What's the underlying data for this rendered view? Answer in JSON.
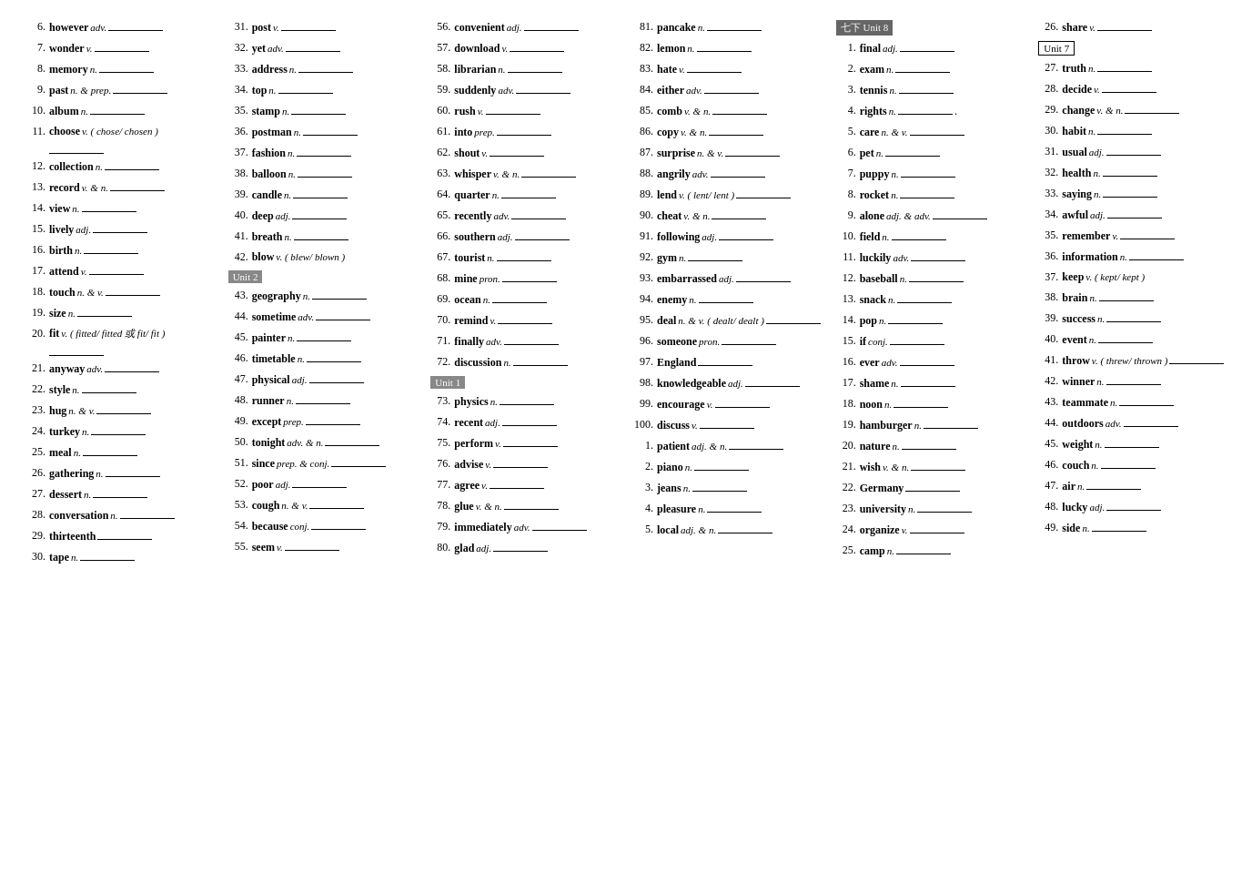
{
  "columns": [
    {
      "id": "col1",
      "entries": [
        {
          "num": "6.",
          "word": "however",
          "pos": "adv.",
          "line": true
        },
        {
          "num": "7.",
          "word": "wonder",
          "pos": "v.",
          "line": true
        },
        {
          "num": "8.",
          "word": "memory",
          "pos": "n.",
          "line": true
        },
        {
          "num": "9.",
          "word": "past",
          "pos": "n. & prep.",
          "line": true
        },
        {
          "num": "10.",
          "word": "album",
          "pos": "n.",
          "line": true
        },
        {
          "num": "11.",
          "word": "choose",
          "pos": "v.  ( chose/ chosen )",
          "note": true,
          "line": true
        },
        {
          "num": "12.",
          "word": "collection",
          "pos": "n.",
          "line": true
        },
        {
          "num": "13.",
          "word": "record",
          "pos": "v. & n.",
          "line": true
        },
        {
          "num": "14.",
          "word": "view",
          "pos": "n.",
          "line": true
        },
        {
          "num": "15.",
          "word": "lively",
          "pos": "adj.",
          "line": true
        },
        {
          "num": "16.",
          "word": "birth",
          "pos": "n.",
          "line": true
        },
        {
          "num": "17.",
          "word": "attend",
          "pos": "v.",
          "line": true
        },
        {
          "num": "18.",
          "word": "touch",
          "pos": "n. & v.",
          "line": true
        },
        {
          "num": "19.",
          "word": "size",
          "pos": "n.",
          "line": true
        },
        {
          "num": "20.",
          "word": "fit",
          "pos": "v.  ( fitted/ fitted 或 fit/ fit )",
          "note": true,
          "line": true
        },
        {
          "num": "21.",
          "word": "anyway",
          "pos": "adv.",
          "line": true
        },
        {
          "num": "22.",
          "word": "style",
          "pos": "n.",
          "line": true
        },
        {
          "num": "23.",
          "word": "hug",
          "pos": "n. & v.",
          "line": true
        },
        {
          "num": "24.",
          "word": "turkey",
          "pos": "n.",
          "line": true
        },
        {
          "num": "25.",
          "word": "meal",
          "pos": "n.",
          "line": true
        },
        {
          "num": "26.",
          "word": "gathering",
          "pos": "n.",
          "line": true
        },
        {
          "num": "27.",
          "word": "dessert",
          "pos": "n.",
          "line": true
        },
        {
          "num": "28.",
          "word": "conversation",
          "pos": "n.",
          "line": true
        },
        {
          "num": "29.",
          "word": "thirteenth",
          "pos": "",
          "line": true
        },
        {
          "num": "30.",
          "word": "tape",
          "pos": "n.",
          "line": true
        }
      ]
    },
    {
      "id": "col2",
      "entries": [
        {
          "num": "31.",
          "word": "post",
          "pos": "v.",
          "line": true
        },
        {
          "num": "32.",
          "word": "yet",
          "pos": "adv.",
          "line": true
        },
        {
          "num": "33.",
          "word": "address",
          "pos": "n.",
          "line": true
        },
        {
          "num": "34.",
          "word": "top",
          "pos": "n.",
          "line": true
        },
        {
          "num": "35.",
          "word": "stamp",
          "pos": "n.",
          "line": true
        },
        {
          "num": "36.",
          "word": "postman",
          "pos": "n.",
          "line": true
        },
        {
          "num": "37.",
          "word": "fashion",
          "pos": "n.",
          "line": true
        },
        {
          "num": "38.",
          "word": "balloon",
          "pos": "n.",
          "line": true
        },
        {
          "num": "39.",
          "word": "candle",
          "pos": "n.",
          "line": true
        },
        {
          "num": "40.",
          "word": "deep",
          "pos": "adj.",
          "line": true
        },
        {
          "num": "41.",
          "word": "breath",
          "pos": "n.",
          "line": true
        },
        {
          "num": "42.",
          "word": "blow",
          "pos": "v. ( blew/ blown )",
          "note": true
        },
        {
          "unit": "Unit 2"
        },
        {
          "num": "43.",
          "word": "geography",
          "pos": "n.",
          "line": true
        },
        {
          "num": "44.",
          "word": "sometime",
          "pos": "adv.",
          "line": true
        },
        {
          "num": "45.",
          "word": "painter",
          "pos": "n.",
          "line": true
        },
        {
          "num": "46.",
          "word": "timetable",
          "pos": "n.",
          "line": true
        },
        {
          "num": "47.",
          "word": "physical",
          "pos": "adj.",
          "line": true
        },
        {
          "num": "48.",
          "word": "runner",
          "pos": "n.",
          "line": true
        },
        {
          "num": "49.",
          "word": "except",
          "pos": "prep.",
          "line": true
        },
        {
          "num": "50.",
          "word": "tonight",
          "pos": "adv. & n.",
          "line": true
        },
        {
          "num": "51.",
          "word": "since",
          "pos": "prep. & conj.",
          "line": true
        },
        {
          "num": "52.",
          "word": "poor",
          "pos": "adj.",
          "line": true
        },
        {
          "num": "53.",
          "word": "cough",
          "pos": "n. & v.",
          "line": true
        },
        {
          "num": "54.",
          "word": "because",
          "pos": "conj.",
          "line": true
        },
        {
          "num": "55.",
          "word": "seem",
          "pos": "v.",
          "line": true
        }
      ]
    },
    {
      "id": "col3",
      "entries": [
        {
          "num": "56.",
          "word": "convenient",
          "pos": "adj.",
          "line": true
        },
        {
          "num": "57.",
          "word": "download",
          "pos": "v.",
          "line": true
        },
        {
          "num": "58.",
          "word": "librarian",
          "pos": "n.",
          "line": true
        },
        {
          "num": "59.",
          "word": "suddenly",
          "pos": "adv.",
          "line": true
        },
        {
          "num": "60.",
          "word": "rush",
          "pos": "v.",
          "line": true
        },
        {
          "num": "61.",
          "word": "into",
          "pos": "prep.",
          "line": true
        },
        {
          "num": "62.",
          "word": "shout",
          "pos": "v.",
          "line": true
        },
        {
          "num": "63.",
          "word": "whisper",
          "pos": "v. & n.",
          "line": true
        },
        {
          "num": "64.",
          "word": "quarter",
          "pos": "n.",
          "line": true
        },
        {
          "num": "65.",
          "word": "recently",
          "pos": "adv.",
          "line": true
        },
        {
          "num": "66.",
          "word": "southern",
          "pos": "adj.",
          "line": true
        },
        {
          "num": "67.",
          "word": "tourist",
          "pos": "n.",
          "line": true
        },
        {
          "num": "68.",
          "word": "mine",
          "pos": "pron.",
          "line": true
        },
        {
          "num": "69.",
          "word": "ocean",
          "pos": "n.",
          "line": true
        },
        {
          "num": "70.",
          "word": "remind",
          "pos": "v.",
          "line": true
        },
        {
          "num": "71.",
          "word": "finally",
          "pos": "adv.",
          "line": true
        },
        {
          "num": "72.",
          "word": "discussion",
          "pos": "n.",
          "line": true
        },
        {
          "unit": "Unit 1"
        },
        {
          "num": "73.",
          "word": "physics",
          "pos": "n.",
          "line": true
        },
        {
          "num": "74.",
          "word": "recent",
          "pos": "adj.",
          "line": true
        },
        {
          "num": "75.",
          "word": "perform",
          "pos": "v.",
          "line": true
        },
        {
          "num": "76.",
          "word": "advise",
          "pos": "v.",
          "line": true
        },
        {
          "num": "77.",
          "word": "agree",
          "pos": "v.",
          "line": true
        },
        {
          "num": "78.",
          "word": "glue",
          "pos": "v. & n.",
          "line": true
        },
        {
          "num": "79.",
          "word": "immediately",
          "pos": "adv.",
          "line": true
        },
        {
          "num": "80.",
          "word": "glad",
          "pos": "adj.",
          "line": true
        }
      ]
    },
    {
      "id": "col4",
      "entries": [
        {
          "num": "81.",
          "word": "pancake",
          "pos": "n.",
          "line": true
        },
        {
          "num": "82.",
          "word": "lemon",
          "pos": "n.",
          "line": true
        },
        {
          "num": "83.",
          "word": "hate",
          "pos": "v.",
          "line": true
        },
        {
          "num": "84.",
          "word": "either",
          "pos": "adv.",
          "line": true
        },
        {
          "num": "85.",
          "word": "comb",
          "pos": "v. & n.",
          "line": true
        },
        {
          "num": "86.",
          "word": "copy",
          "pos": "v. & n.",
          "line": true
        },
        {
          "num": "87.",
          "word": "surprise",
          "pos": "n. & v.",
          "line": true
        },
        {
          "num": "88.",
          "word": "angrily",
          "pos": "adv.",
          "line": true
        },
        {
          "num": "89.",
          "word": "lend",
          "pos": "v. ( lent/ lent )",
          "note": true,
          "line": true
        },
        {
          "num": "90.",
          "word": "cheat",
          "pos": "v. & n.",
          "line": true
        },
        {
          "num": "91.",
          "word": "following",
          "pos": "adj.",
          "line": true
        },
        {
          "num": "92.",
          "word": "gym",
          "pos": "n.",
          "line": true
        },
        {
          "num": "93.",
          "word": "embarrassed",
          "pos": "adj.",
          "line": true
        },
        {
          "num": "94.",
          "word": "enemy",
          "pos": "n.",
          "line": true
        },
        {
          "num": "95.",
          "word": "deal",
          "pos": "n. & v.  ( dealt/ dealt )",
          "note": true,
          "line": true
        },
        {
          "num": "96.",
          "word": "someone",
          "pos": "pron.",
          "line": true
        },
        {
          "num": "97.",
          "word": "England",
          "pos": "",
          "line": true
        },
        {
          "num": "98.",
          "word": "knowledgeable",
          "pos": "adj.",
          "line": true
        },
        {
          "num": "99.",
          "word": "encourage",
          "pos": "v.",
          "line": true
        },
        {
          "num": "100.",
          "word": "discuss",
          "pos": "v.",
          "line": true
        },
        {
          "num": "1.",
          "word": "patient",
          "pos": "adj. & n.",
          "line": true
        },
        {
          "num": "2.",
          "word": "piano",
          "pos": "n.",
          "line": true
        },
        {
          "num": "3.",
          "word": "jeans",
          "pos": "n.",
          "line": true
        },
        {
          "num": "4.",
          "word": "pleasure",
          "pos": "n.",
          "line": true
        },
        {
          "num": "5.",
          "word": "local",
          "pos": "adj. & n.",
          "line": true
        }
      ]
    },
    {
      "id": "col5",
      "entries": [
        {
          "unit_badge_dark": "七下 Unit 8"
        },
        {
          "num": "1.",
          "word": "final",
          "pos": "adj.",
          "line": true
        },
        {
          "num": "2.",
          "word": "exam",
          "pos": "n.",
          "line": true
        },
        {
          "num": "3.",
          "word": "tennis",
          "pos": "n.",
          "line": true
        },
        {
          "num": "4.",
          "word": "rights",
          "pos": "n.",
          "line": true,
          "dot": true
        },
        {
          "num": "5.",
          "word": "care",
          "pos": "n. & v.",
          "line": true
        },
        {
          "num": "6.",
          "word": "pet",
          "pos": "n.",
          "line": true
        },
        {
          "num": "7.",
          "word": "puppy",
          "pos": "n.",
          "line": true
        },
        {
          "num": "8.",
          "word": "rocket",
          "pos": "n.",
          "line": true
        },
        {
          "num": "9.",
          "word": "alone",
          "pos": "adj. & adv.",
          "line": true
        },
        {
          "num": "10.",
          "word": "field",
          "pos": "n.",
          "line": true
        },
        {
          "num": "11.",
          "word": "luckily",
          "pos": "adv.",
          "line": true
        },
        {
          "num": "12.",
          "word": "baseball",
          "pos": "n.",
          "line": true
        },
        {
          "num": "13.",
          "word": "snack",
          "pos": "n.",
          "line": true
        },
        {
          "num": "14.",
          "word": "pop",
          "pos": "n.",
          "line": true
        },
        {
          "num": "15.",
          "word": "if",
          "pos": "conj.",
          "line": true
        },
        {
          "num": "16.",
          "word": "ever",
          "pos": "adv.",
          "line": true
        },
        {
          "num": "17.",
          "word": "shame",
          "pos": "n.",
          "line": true
        },
        {
          "num": "18.",
          "word": "noon",
          "pos": "n.",
          "line": true
        },
        {
          "num": "19.",
          "word": "hamburger",
          "pos": "n.",
          "line": true
        },
        {
          "num": "20.",
          "word": "nature",
          "pos": "n.",
          "line": true
        },
        {
          "num": "21.",
          "word": "wish",
          "pos": "v. & n.",
          "line": true
        },
        {
          "num": "22.",
          "word": "Germany",
          "pos": "",
          "line": true
        },
        {
          "num": "23.",
          "word": "university",
          "pos": "n.",
          "line": true
        },
        {
          "num": "24.",
          "word": "organize",
          "pos": "v.",
          "line": true
        },
        {
          "num": "25.",
          "word": "camp",
          "pos": "n.",
          "line": true
        }
      ]
    },
    {
      "id": "col6",
      "entries": [
        {
          "num": "26.",
          "word": "share",
          "pos": "v.",
          "line": true
        },
        {
          "unit_badge_outline": "Unit 7"
        },
        {
          "num": "27.",
          "word": "truth",
          "pos": "n.",
          "line": true
        },
        {
          "num": "28.",
          "word": "decide",
          "pos": "v.",
          "line": true
        },
        {
          "num": "29.",
          "word": "change",
          "pos": "v. & n.",
          "line": true
        },
        {
          "num": "30.",
          "word": "habit",
          "pos": "n.",
          "line": true
        },
        {
          "num": "31.",
          "word": "usual",
          "pos": "adj.",
          "line": true
        },
        {
          "num": "32.",
          "word": "health",
          "pos": "n.",
          "line": true
        },
        {
          "num": "33.",
          "word": "saying",
          "pos": "n.",
          "line": true
        },
        {
          "num": "34.",
          "word": "awful",
          "pos": "adj.",
          "line": true
        },
        {
          "num": "35.",
          "word": "remember",
          "pos": "v.",
          "line": true
        },
        {
          "num": "36.",
          "word": "information",
          "pos": "n.",
          "line": true
        },
        {
          "num": "37.",
          "word": "keep",
          "pos": "v. ( kept/ kept )",
          "note": true
        },
        {
          "num": "38.",
          "word": "brain",
          "pos": "n.",
          "line": true
        },
        {
          "num": "39.",
          "word": "success",
          "pos": "n.",
          "line": true
        },
        {
          "num": "40.",
          "word": "event",
          "pos": "n.",
          "line": true
        },
        {
          "num": "41.",
          "word": "throw",
          "pos": "v.  ( threw/ thrown )",
          "note": true,
          "line": true
        },
        {
          "num": "42.",
          "word": "winner",
          "pos": "n.",
          "line": true
        },
        {
          "num": "43.",
          "word": "teammate",
          "pos": "n.",
          "line": true
        },
        {
          "num": "44.",
          "word": "outdoors",
          "pos": "adv.",
          "line": true
        },
        {
          "num": "45.",
          "word": "weight",
          "pos": "n.",
          "line": true
        },
        {
          "num": "46.",
          "word": "couch",
          "pos": "n.",
          "line": true
        },
        {
          "num": "47.",
          "word": "air",
          "pos": "n.",
          "line": true
        },
        {
          "num": "48.",
          "word": "lucky",
          "pos": "adj.",
          "line": true
        },
        {
          "num": "49.",
          "word": "side",
          "pos": "n.",
          "line": true
        }
      ]
    }
  ]
}
